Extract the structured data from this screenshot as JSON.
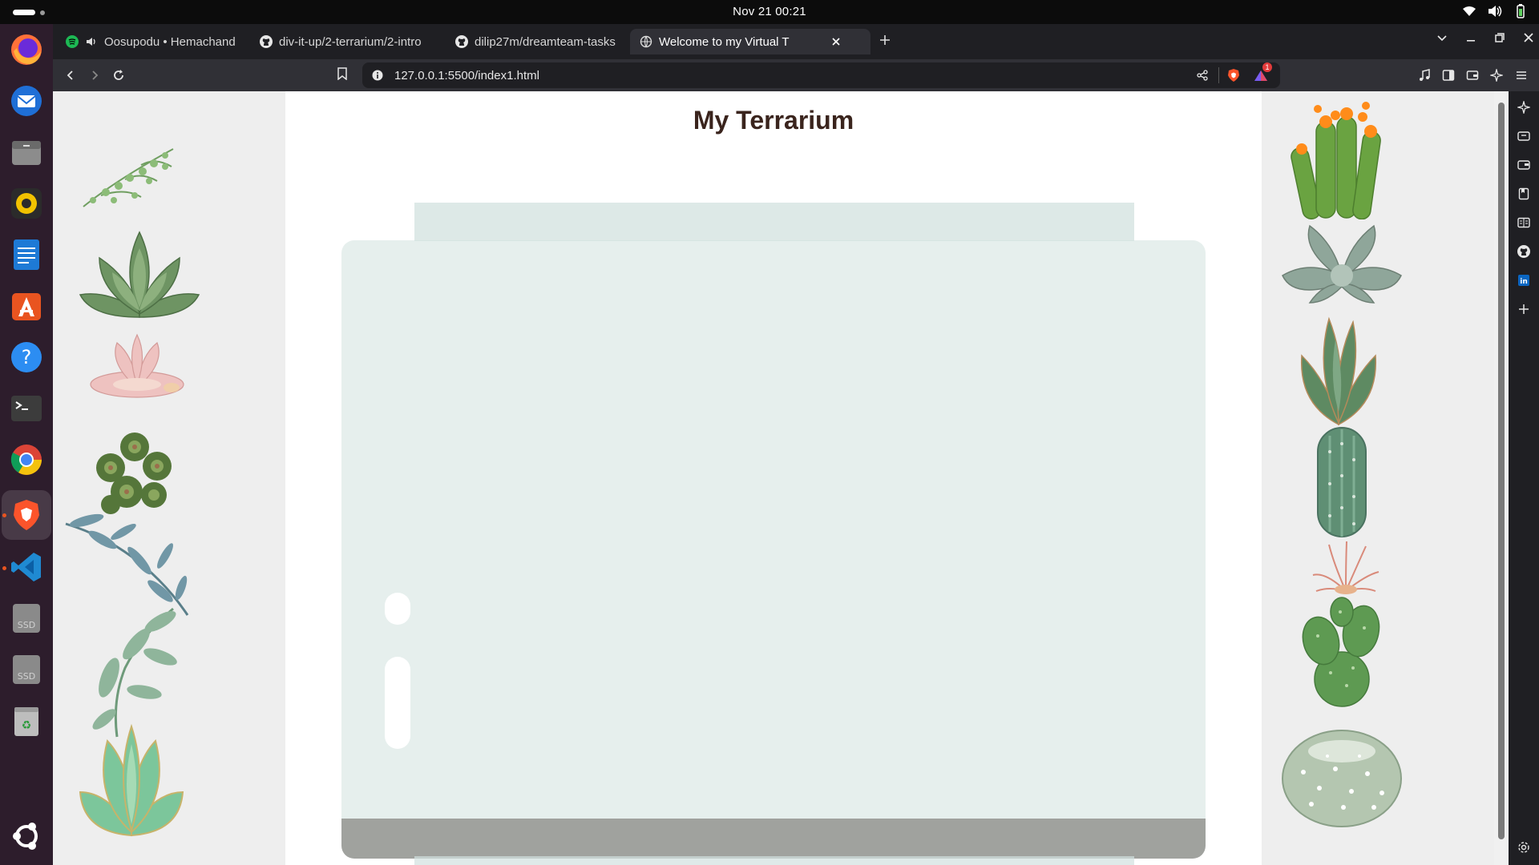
{
  "system": {
    "clock": "Nov 21  00:21",
    "tray_icons": [
      "wifi-icon",
      "volume-icon",
      "battery-icon"
    ]
  },
  "dock": {
    "apps": [
      "Firefox",
      "Thunderbird",
      "Files",
      "Rhythmbox",
      "LibreOffice Writer",
      "App Center",
      "Help",
      "Terminal",
      "Google Chrome",
      "Brave",
      "Visual Studio Code",
      "SSD",
      "SSD",
      "Trash",
      "Show Apps"
    ],
    "ssd_label": "SSD"
  },
  "browser": {
    "tabs": [
      {
        "title": "Oosupodu • Hemachandr",
        "icon": "spotify-icon",
        "audio": true
      },
      {
        "title": "div-it-up/2-terrarium/2-intro",
        "icon": "github-icon"
      },
      {
        "title": "dilip27m/dreamteam-tasks",
        "icon": "github-icon"
      },
      {
        "title": "Welcome to my Virtual T",
        "icon": "globe-icon",
        "active": true
      }
    ],
    "url": "127.0.0.1:5500/index1.html",
    "shields_badge": "1",
    "colors": {
      "tabstrip": "#1f1f23",
      "toolbar": "#303036",
      "brave": "#fb542b"
    }
  },
  "page": {
    "title": "My Terrarium",
    "colors": {
      "side_panels": "#eeeeee",
      "jar": "#d1e1df",
      "dirt": "#a0a29e",
      "title": "#3a241d"
    },
    "left_plants": [
      "plant1",
      "plant2",
      "plant3",
      "plant4",
      "plant5",
      "plant6",
      "plant7"
    ],
    "right_plants": [
      "plant8",
      "plant9",
      "plant10",
      "plant11",
      "plant12",
      "plant13",
      "plant14"
    ]
  }
}
